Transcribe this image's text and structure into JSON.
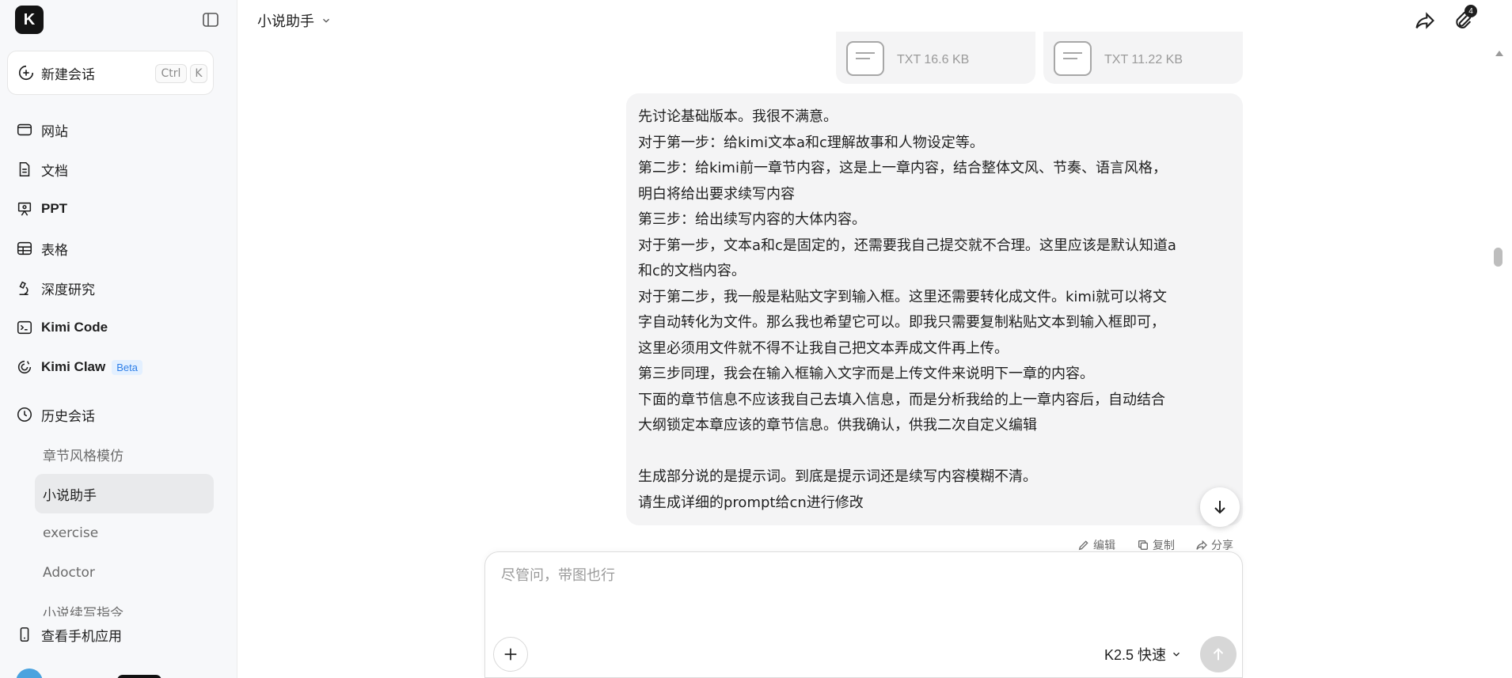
{
  "sidebar": {
    "logo_letter": "K",
    "new_chat": {
      "label": "新建会话",
      "shortcut_ctrl": "Ctrl",
      "shortcut_key": "K"
    },
    "nav": [
      {
        "label": "网站",
        "icon": "browser-icon"
      },
      {
        "label": "文档",
        "icon": "document-icon"
      },
      {
        "label": "PPT",
        "icon": "presentation-icon"
      },
      {
        "label": "表格",
        "icon": "table-icon"
      },
      {
        "label": "深度研究",
        "icon": "microscope-icon"
      },
      {
        "label": "Kimi Code",
        "icon": "terminal-icon"
      },
      {
        "label": "Kimi Claw",
        "icon": "claw-icon",
        "badge": "Beta"
      }
    ],
    "history": {
      "label": "历史会话",
      "items": [
        "章节风格模仿",
        "小说助手",
        "exercise",
        "Adoctor",
        "小说续写指令"
      ],
      "active_index": 1
    },
    "mobile_app": "查看手机应用"
  },
  "header": {
    "title": "小说助手",
    "attachment_count": "4"
  },
  "files": [
    {
      "meta": "TXT 16.6 KB"
    },
    {
      "meta": "TXT 11.22 KB"
    }
  ],
  "message": {
    "lines": [
      "先讨论基础版本。我很不满意。",
      "对于第一步：给kimi文本a和c理解故事和人物设定等。",
      "第二步：给kimi前一章节内容，这是上一章内容，结合整体文风、节奏、语言风格，",
      "明白将给出要求续写内容",
      "第三步：给出续写内容的大体内容。",
      "对于第一步，文本a和c是固定的，还需要我自己提交就不合理。这里应该是默认知道a",
      "和c的文档内容。",
      "对于第二步，我一般是粘贴文字到输入框。这里还需要转化成文件。kimi就可以将文",
      "字自动转化为文件。那么我也希望它可以。即我只需要复制粘贴文本到输入框即可，",
      "这里必须用文件就不得不让我自己把文本弄成文件再上传。",
      "第三步同理，我会在输入框输入文字而是上传文件来说明下一章的内容。",
      "下面的章节信息不应该我自己去填入信息，而是分析我给的上一章内容后，自动结合",
      "大纲锁定本章应该的章节信息。供我确认，供我二次自定义编辑",
      "",
      "生成部分说的是提示词。到底是提示词还是续写内容模糊不清。",
      "请生成详细的prompt给cn进行修改"
    ],
    "actions": {
      "edit": "编辑",
      "copy": "复制",
      "share": "分享"
    }
  },
  "composer": {
    "placeholder": "尽管问，带图也行",
    "model": "K2.5 快速"
  }
}
